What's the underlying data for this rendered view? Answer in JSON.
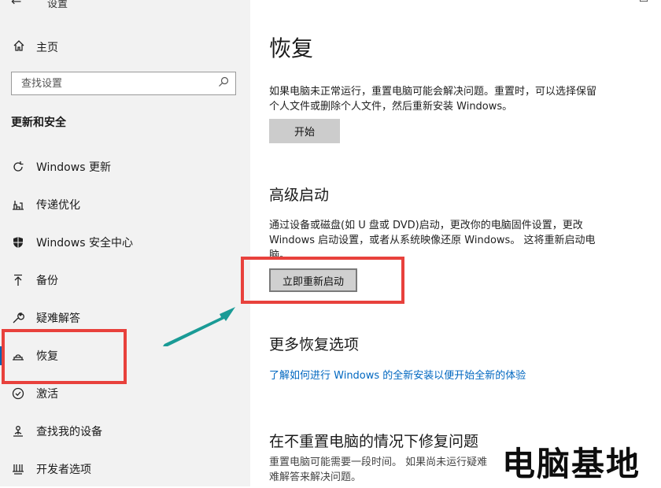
{
  "app": {
    "back_glyph": "←",
    "title": "设置"
  },
  "window_controls": {
    "minimize": "—",
    "maximize": "☐"
  },
  "sidebar": {
    "home": {
      "icon": "home-icon",
      "label": "主页"
    },
    "search": {
      "placeholder": "查找设置",
      "icon": "search-icon"
    },
    "section_title": "更新和安全",
    "items": [
      {
        "icon": "refresh-icon",
        "label": "Windows 更新"
      },
      {
        "icon": "delivery-optimization-icon",
        "label": "传递优化"
      },
      {
        "icon": "shield-icon",
        "label": "Windows 安全中心"
      },
      {
        "icon": "backup-arrow-icon",
        "label": "备份"
      },
      {
        "icon": "wrench-icon",
        "label": "疑难解答"
      },
      {
        "icon": "recovery-icon",
        "label": "恢复",
        "active": true
      },
      {
        "icon": "activation-check-icon",
        "label": "激活"
      },
      {
        "icon": "find-device-icon",
        "label": "查找我的设备"
      },
      {
        "icon": "developer-icon",
        "label": "开发者选项"
      }
    ]
  },
  "main": {
    "title": "恢复",
    "reset": {
      "description_line1": "如果电脑未正常运行，重置电脑可能会解决问题。重置时，可以选择保留",
      "description_line2": "个人文件或删除个人文件，然后重新安装 Windows。",
      "button": "开始"
    },
    "advanced_startup": {
      "heading": "高级启动",
      "description_line1": "通过设备或磁盘(如 U 盘或 DVD)启动，更改你的电脑固件设置，更改",
      "description_line2": "Windows 启动设置，或者从系统映像还原 Windows。 这将重新启动电",
      "description_line3": "脑。",
      "button": "立即重新启动"
    },
    "more_options": {
      "heading": "更多恢复选项",
      "link": "了解如何进行 Windows 的全新安装以便开始全新的体验"
    },
    "fix_without_reset": {
      "heading": "在不重置电脑的情况下修复问题",
      "description_line1": "重置电脑可能需要一段时间。 如果尚未运行疑难",
      "description_line2": "难解答来解决问题。"
    }
  },
  "watermark": "电脑基地",
  "colors": {
    "highlight": "#e8413c",
    "arrow": "#1a9b96",
    "link": "#0067c0",
    "accent": "#0063b1"
  }
}
